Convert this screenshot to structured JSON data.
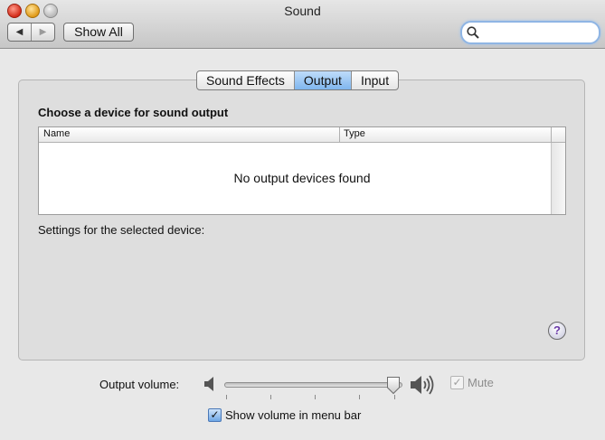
{
  "window": {
    "title": "Sound"
  },
  "toolbar": {
    "back_icon": "triangle-left-icon",
    "forward_icon": "triangle-right-icon",
    "show_all_label": "Show All",
    "search": {
      "value": "",
      "placeholder": "",
      "icon": "search-icon"
    }
  },
  "tabs": [
    {
      "label": "Sound Effects",
      "active": false
    },
    {
      "label": "Output",
      "active": true
    },
    {
      "label": "Input",
      "active": false
    }
  ],
  "output": {
    "heading": "Choose a device for sound output",
    "columns": {
      "name": "Name",
      "type": "Type"
    },
    "empty_message": "No output devices found",
    "settings_label": "Settings for the selected device:",
    "help_label": "?"
  },
  "volume": {
    "label": "Output volume:",
    "level": 0.95,
    "mute_label": "Mute",
    "mute_checked": true,
    "mute_enabled": false,
    "show_in_menubar_label": "Show volume in menu bar",
    "show_in_menubar_checked": true
  },
  "colors": {
    "active_tab": "#7fb6ee",
    "help_glyph": "#6b3aa8"
  }
}
